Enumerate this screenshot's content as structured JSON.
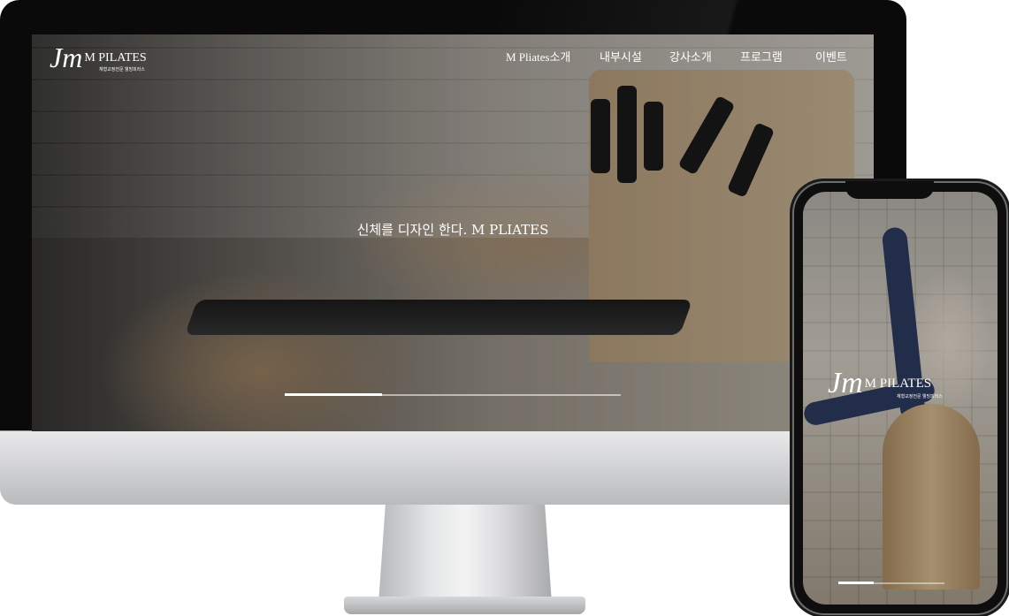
{
  "brand": {
    "mark": "Jm",
    "name": "M PILATES",
    "tagline": "체형교정전문 웰빙피라스"
  },
  "nav": {
    "items": [
      {
        "label": "M Pliates소개"
      },
      {
        "label": "내부시설"
      },
      {
        "label": "강사소개"
      },
      {
        "label": "프로그램"
      },
      {
        "label": "이벤트"
      }
    ]
  },
  "hero": {
    "headline": "신체를 디자인 한다. M PLIATES",
    "slide_progress": 0.29
  },
  "mobile": {
    "slide_progress": 0.33
  },
  "colors": {
    "nav_text": "#ffffff",
    "device_frame": "#0a0a0a",
    "monitor_silver": "#cfd0d2"
  }
}
